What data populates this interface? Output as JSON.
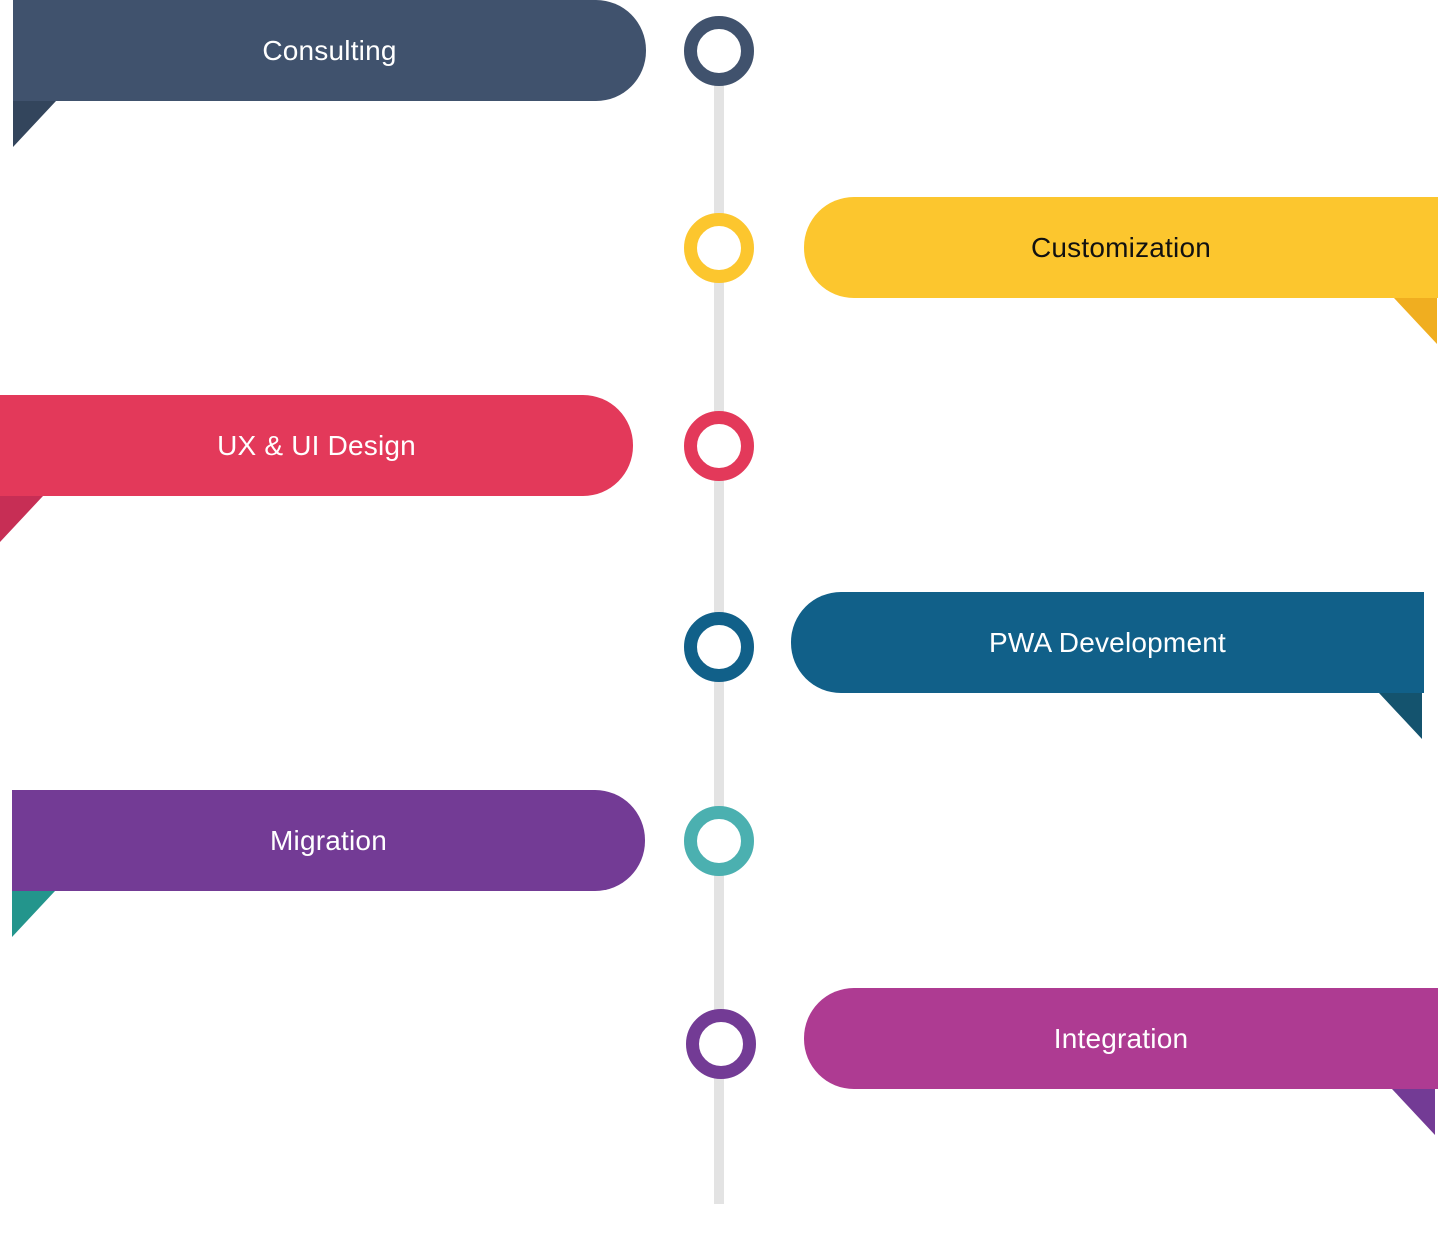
{
  "steps": [
    {
      "label": "Consulting",
      "side": "left",
      "color": "#40526d",
      "fold_color": "#33455c",
      "node_color": "#40526d",
      "text_color": "#ffffff"
    },
    {
      "label": "Customization",
      "side": "right",
      "color": "#fcc62e",
      "fold_color": "#f0ae20",
      "node_color": "#fcc62e",
      "text_color": "#111111"
    },
    {
      "label": "UX & UI Design",
      "side": "left",
      "color": "#e3395a",
      "fold_color": "#c72e55",
      "node_color": "#e3395a",
      "text_color": "#ffffff"
    },
    {
      "label": "PWA Development",
      "side": "right",
      "color": "#116089",
      "fold_color": "#14536e",
      "node_color": "#116089",
      "text_color": "#ffffff"
    },
    {
      "label": "Migration",
      "side": "left",
      "color": "#733b95",
      "fold_color": "#23958c",
      "node_color": "#4bb0b0",
      "text_color": "#ffffff"
    },
    {
      "label": "Integration",
      "side": "right",
      "color": "#ae3b92",
      "fold_color": "#733b95",
      "node_color": "#733b95",
      "text_color": "#ffffff"
    }
  ]
}
